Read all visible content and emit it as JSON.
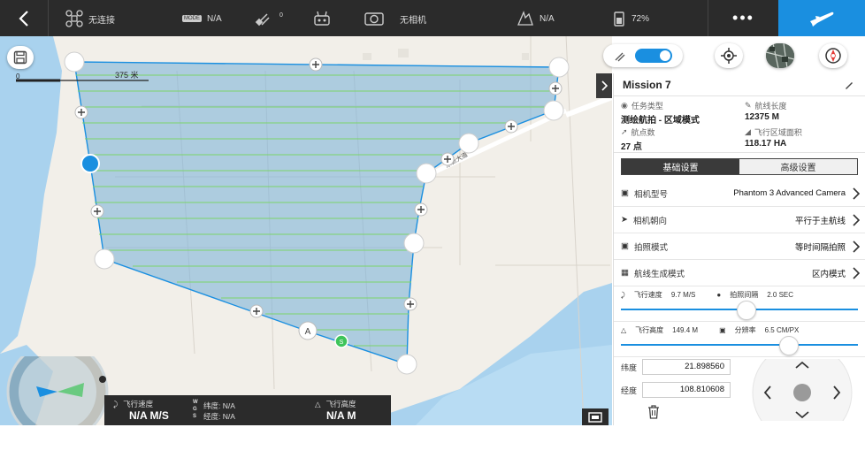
{
  "topbar": {
    "connection_status": "无连接",
    "mode_text": "N/A",
    "gps_count": "0",
    "camera_status": "无相机",
    "rc_signal": "N/A",
    "battery": "72%",
    "more_label": "•••"
  },
  "map": {
    "scale_zero": "0",
    "scale_distance": "375 米",
    "road_label": "东新大道",
    "start_marker": "S",
    "home_marker": "A"
  },
  "hud": {
    "flight_speed_label": "飞行速度",
    "flight_speed_value": "N/A M/S",
    "latitude_label": "纬度: N/A",
    "longitude_label": "经度: N/A",
    "wgs_label": "W G S",
    "altitude_label": "飞行高度",
    "altitude_value": "N/A M"
  },
  "panel": {
    "title": "Mission 7",
    "task_type_label": "任务类型",
    "task_type_value": "测绘航拍 - 区域模式",
    "route_length_label": "航线长度",
    "route_length_value": "12375 M",
    "waypoints_label": "航点数",
    "waypoints_value": "27 点",
    "area_label": "飞行区域面积",
    "area_value": "118.17 HA",
    "tab_basic": "基础设置",
    "tab_advanced": "高级设置",
    "camera_model_label": "相机型号",
    "camera_model_value": "Phantom 3 Advanced Camera",
    "camera_heading_label": "相机朝向",
    "camera_heading_value": "平行于主航线",
    "shoot_mode_label": "拍照模式",
    "shoot_mode_value": "等时间隔拍照",
    "route_mode_label": "航线生成模式",
    "route_mode_value": "区内模式",
    "speed_label": "飞行速度",
    "speed_value": "9.7 M/S",
    "interval_label": "拍照间隔",
    "interval_value": "2.0 SEC",
    "speed_slider_fraction": 0.53,
    "altitude_label": "飞行高度",
    "altitude_value": "149.4 M",
    "resolution_label": "分辨率",
    "resolution_value": "6.5 CM/PX",
    "altitude_slider_fraction": 0.71,
    "lat_label": "纬度",
    "lat_value": "21.898560",
    "lon_label": "经度",
    "lon_value": "108.810608"
  },
  "colors": {
    "accent": "#1a8fe0",
    "polygon_fill": "#7fb4d8",
    "route_lines": "#7cd36a",
    "water": "#a9d2ee"
  }
}
